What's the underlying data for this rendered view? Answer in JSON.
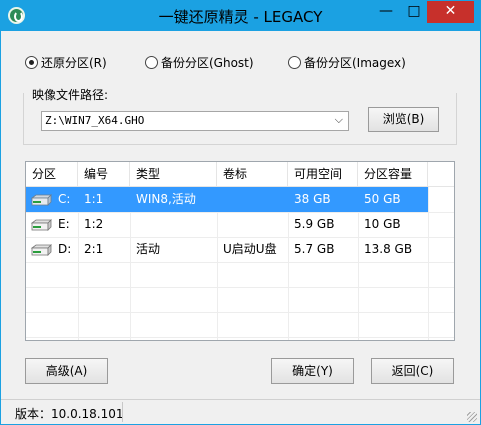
{
  "window": {
    "title": "一键还原精灵 - LEGACY",
    "minimize_glyph": "—",
    "maximize_glyph": "□",
    "close_glyph": "✕"
  },
  "modes": [
    {
      "label": "还原分区(R)",
      "selected": true
    },
    {
      "label": "备份分区(Ghost)",
      "selected": false
    },
    {
      "label": "备份分区(Imagex)",
      "selected": false
    }
  ],
  "image_path": {
    "group_label": "映像文件路径:",
    "value": "Z:\\WIN7_X64.GHO",
    "browse_label": "浏览(B)"
  },
  "table": {
    "headers": [
      "分区",
      "编号",
      "类型",
      "卷标",
      "可用空间",
      "分区容量"
    ],
    "rows": [
      {
        "partition": "C:",
        "number": "1:1",
        "type": "WIN8,活动",
        "label": "",
        "free": "38 GB",
        "capacity": "50 GB",
        "selected": true
      },
      {
        "partition": "E:",
        "number": "1:2",
        "type": "",
        "label": "",
        "free": "5.9 GB",
        "capacity": "10 GB",
        "selected": false
      },
      {
        "partition": "D:",
        "number": "2:1",
        "type": "活动",
        "label": "U启动U盘",
        "free": "5.7 GB",
        "capacity": "13.8 GB",
        "selected": false
      }
    ]
  },
  "buttons": {
    "advanced": "高级(A)",
    "ok": "确定(Y)",
    "back": "返回(C)"
  },
  "status": {
    "version": "版本：10.0.18.101"
  },
  "colors": {
    "titlebar": "#1ba1e2",
    "close": "#c7302b",
    "selection": "#3399ff"
  }
}
